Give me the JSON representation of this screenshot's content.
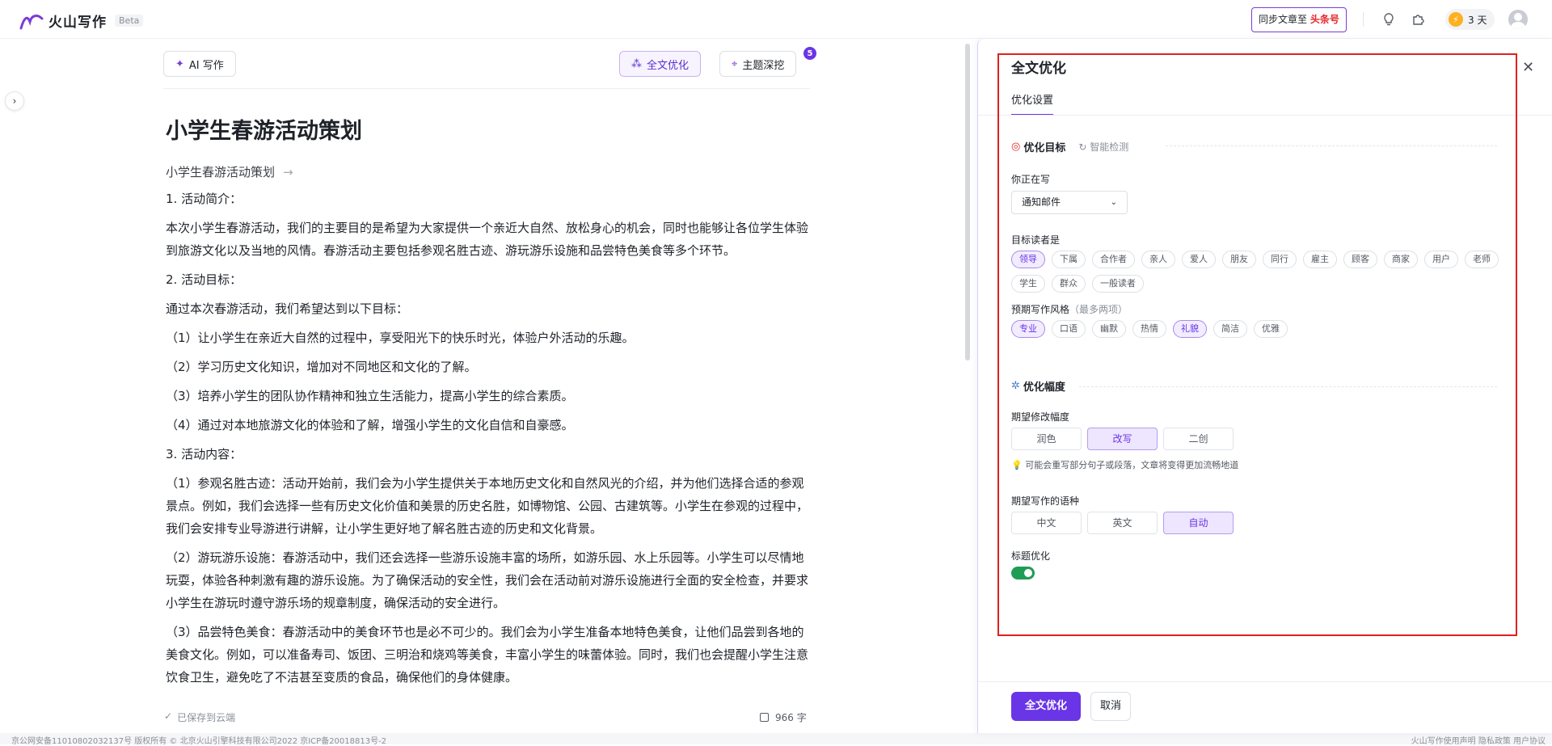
{
  "topbar": {
    "app_name": "火山写作",
    "beta": "Beta",
    "sync_prefix": "同步文章至",
    "sync_target": "头条号",
    "days": "3 天",
    "coin_symbol": "⚡"
  },
  "editor": {
    "ai_write_label": "AI 写作",
    "full_optimize_label": "全文优化",
    "topic_dig_label": "主题深挖",
    "topic_badge": "5",
    "title": "小学生春游活动策划",
    "subtitle": "小学生春游活动策划",
    "paragraphs": [
      "1. 活动简介：",
      "本次小学生春游活动，我们的主要目的是希望为大家提供一个亲近大自然、放松身心的机会，同时也能够让各位学生体验到旅游文化以及当地的风情。春游活动主要包括参观名胜古迹、游玩游乐设施和品尝特色美食等多个环节。",
      "2. 活动目标：",
      "通过本次春游活动，我们希望达到以下目标：",
      "（1）让小学生在亲近大自然的过程中，享受阳光下的快乐时光，体验户外活动的乐趣。",
      "（2）学习历史文化知识，增加对不同地区和文化的了解。",
      "（3）培养小学生的团队协作精神和独立生活能力，提高小学生的综合素质。",
      "（4）通过对本地旅游文化的体验和了解，增强小学生的文化自信和自豪感。",
      "3. 活动内容：",
      "（1）参观名胜古迹：活动开始前，我们会为小学生提供关于本地历史文化和自然风光的介绍，并为他们选择合适的参观景点。例如，我们会选择一些有历史文化价值和美景的历史名胜，如博物馆、公园、古建筑等。小学生在参观的过程中，我们会安排专业导游进行讲解，让小学生更好地了解名胜古迹的历史和文化背景。",
      "（2）游玩游乐设施：春游活动中，我们还会选择一些游乐设施丰富的场所，如游乐园、水上乐园等。小学生可以尽情地玩耍，体验各种刺激有趣的游乐设施。为了确保活动的安全性，我们会在活动前对游乐设施进行全面的安全检查，并要求小学生在游玩时遵守游乐场的规章制度，确保活动的安全进行。",
      "（3）品尝特色美食：春游活动中的美食环节也是必不可少的。我们会为小学生准备本地特色美食，让他们品尝到各地的美食文化。例如，可以准备寿司、饭团、三明治和烧鸡等美食，丰富小学生的味蕾体验。同时，我们也会提醒小学生注意饮食卫生，避免吃了不洁甚至变质的食品，确保他们的身体健康。"
    ],
    "saved_status": "已保存到云端",
    "word_count": "966 字"
  },
  "footer": {
    "left": "京公网安备11010802032137号    版权所有 © 北京火山引擎科技有限公司2022  京ICP备20018813号-2",
    "right": "火山写作使用声明  隐私政策  用户协议"
  },
  "panel": {
    "title": "全文优化",
    "tab": "优化设置",
    "section_goal": "优化目标",
    "smart_detect": "智能检测",
    "writing_label": "你正在写",
    "writing_value": "通知邮件",
    "reader_label": "目标读者是",
    "readers": [
      "领导",
      "下属",
      "合作者",
      "亲人",
      "爱人",
      "朋友",
      "同行",
      "雇主",
      "顾客",
      "商家",
      "用户",
      "老师",
      "学生",
      "群众",
      "一般读者"
    ],
    "style_label": "预期写作风格",
    "style_sub": "（最多两项）",
    "styles": [
      "专业",
      "口语",
      "幽默",
      "热情",
      "礼貌",
      "简洁",
      "优雅"
    ],
    "section_range": "优化幅度",
    "range_label": "期望修改幅度",
    "ranges": [
      "润色",
      "改写",
      "二创"
    ],
    "range_hint": "可能会重写部分句子或段落，文章将变得更加流畅地道",
    "lang_label": "期望写作的语种",
    "langs": [
      "中文",
      "英文",
      "自动"
    ],
    "title_opt_label": "标题优化",
    "submit": "全文优化",
    "cancel": "取消"
  },
  "colors": {
    "accent": "#6a35e6",
    "highlight_box": "#e02020",
    "toggle_on": "#1f9d55"
  }
}
